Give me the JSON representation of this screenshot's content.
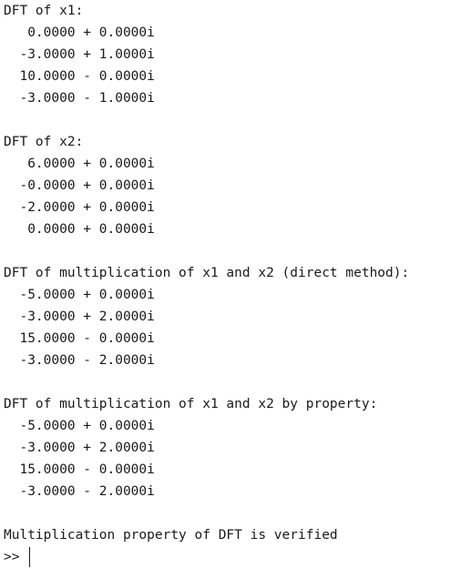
{
  "console": {
    "blocks": [
      {
        "title": "DFT of x1:",
        "values": [
          "   0.0000 + 0.0000i",
          "  -3.0000 + 1.0000i",
          "  10.0000 - 0.0000i",
          "  -3.0000 - 1.0000i"
        ]
      },
      {
        "title": "DFT of x2:",
        "values": [
          "   6.0000 + 0.0000i",
          "  -0.0000 + 0.0000i",
          "  -2.0000 + 0.0000i",
          "   0.0000 + 0.0000i"
        ]
      },
      {
        "title": "DFT of multiplication of x1 and x2 (direct method):",
        "values": [
          "  -5.0000 + 0.0000i",
          "  -3.0000 + 2.0000i",
          "  15.0000 - 0.0000i",
          "  -3.0000 - 2.0000i"
        ]
      },
      {
        "title": "DFT of multiplication of x1 and x2 by property:",
        "values": [
          "  -5.0000 + 0.0000i",
          "  -3.0000 + 2.0000i",
          "  15.0000 - 0.0000i",
          "  -3.0000 - 2.0000i"
        ]
      }
    ],
    "result_message": "Multiplication property of DFT is verified",
    "prompt": ">> "
  }
}
